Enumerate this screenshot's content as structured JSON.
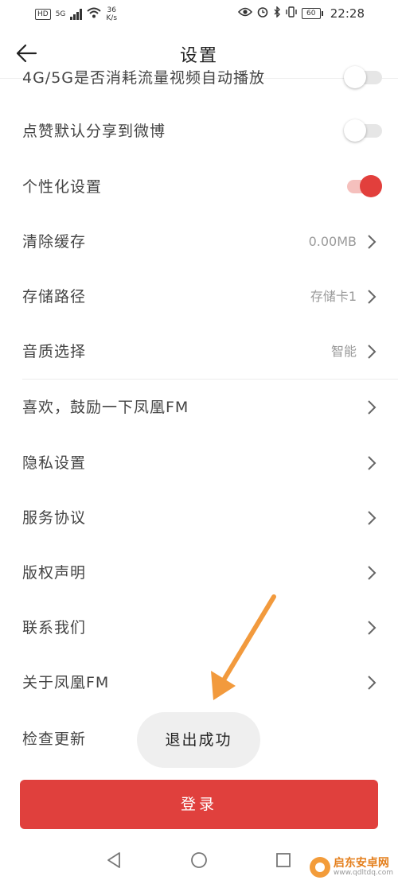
{
  "status_bar": {
    "hd": "HD",
    "network": "5G",
    "speed": "36\nK/s",
    "battery": "60",
    "time": "22:28"
  },
  "header": {
    "title": "设置"
  },
  "settings": {
    "partial_label": "4G/5G是否消耗流量视频自动播放",
    "weibo_share": {
      "label": "点赞默认分享到微博",
      "enabled": false
    },
    "personalized": {
      "label": "个性化设置",
      "enabled": true
    },
    "clear_cache": {
      "label": "清除缓存",
      "value": "0.00MB"
    },
    "storage_path": {
      "label": "存储路径",
      "value": "存储卡1"
    },
    "audio_quality": {
      "label": "音质选择",
      "value": "智能"
    },
    "encourage": {
      "label": "喜欢，鼓励一下凤凰FM"
    },
    "privacy": {
      "label": "隐私设置"
    },
    "service_agreement": {
      "label": "服务协议"
    },
    "copyright": {
      "label": "版权声明"
    },
    "contact": {
      "label": "联系我们"
    },
    "about": {
      "label": "关于凤凰FM"
    },
    "check_update": {
      "label": "检查更新"
    }
  },
  "toast": "退出成功",
  "login_button": "登录",
  "watermark": {
    "name": "启东安卓网",
    "url": "www.qdltdq.com"
  },
  "colors": {
    "accent": "#e0403d",
    "annotation_arrow": "#f29a3d"
  }
}
